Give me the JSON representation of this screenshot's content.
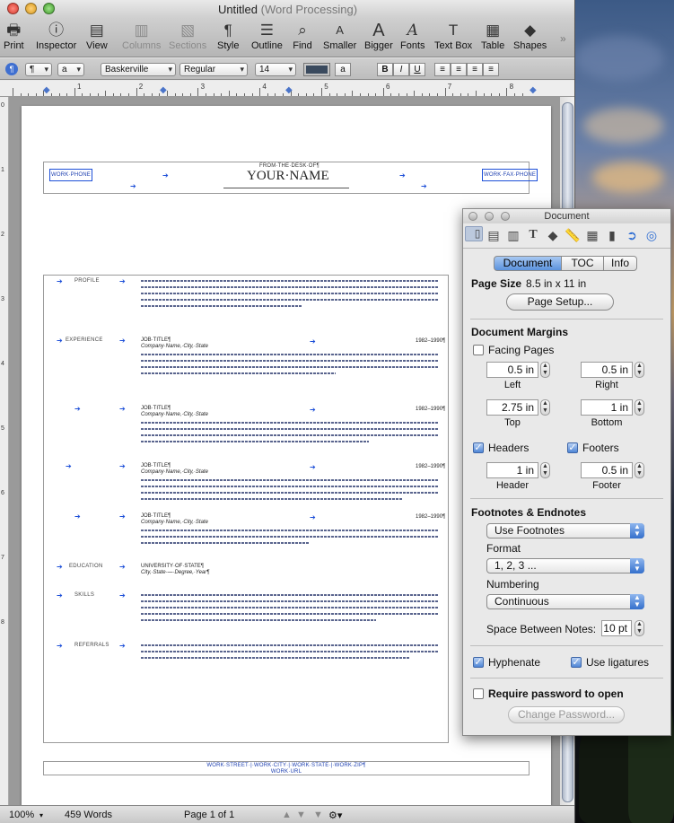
{
  "window": {
    "title": "Untitled",
    "subtitle": "(Word Processing)"
  },
  "toolbar": {
    "items": [
      {
        "label": "Print",
        "icon": "printer-icon",
        "enabled": true
      },
      {
        "label": "Inspector",
        "icon": "info-icon",
        "enabled": true
      },
      {
        "label": "View",
        "icon": "view-icon",
        "enabled": true
      },
      {
        "label": "Columns",
        "icon": "columns-icon",
        "enabled": false
      },
      {
        "label": "Sections",
        "icon": "sections-icon",
        "enabled": false
      },
      {
        "label": "Style",
        "icon": "paragraph-icon",
        "enabled": true
      },
      {
        "label": "Outline",
        "icon": "outline-icon",
        "enabled": true
      },
      {
        "label": "Find",
        "icon": "magnifier-icon",
        "enabled": true
      },
      {
        "label": "Smaller",
        "icon": "smaller-text-icon",
        "enabled": true
      },
      {
        "label": "Bigger",
        "icon": "bigger-text-icon",
        "enabled": true
      },
      {
        "label": "Fonts",
        "icon": "fonts-icon",
        "enabled": true
      },
      {
        "label": "Text Box",
        "icon": "textbox-icon",
        "enabled": true
      },
      {
        "label": "Table",
        "icon": "table-icon",
        "enabled": true
      },
      {
        "label": "Shapes",
        "icon": "shapes-icon",
        "enabled": true
      }
    ],
    "overflow_icon": "chevron-right-icon"
  },
  "formatbar": {
    "paragraph_style": "¶",
    "character_style": "a",
    "font_family": "Baskerville",
    "font_style": "Regular",
    "font_size": "14",
    "text_color_sample": "#3a4a5e",
    "highlight_label": "a",
    "bold": "B",
    "italic": "I",
    "underline": "U"
  },
  "ruler": {
    "h_numbers": [
      "1",
      "2",
      "3",
      "4",
      "5",
      "6",
      "7",
      "8"
    ],
    "v_numbers": [
      "0",
      "1",
      "2",
      "3",
      "4",
      "5",
      "6",
      "7",
      "8"
    ]
  },
  "document": {
    "header": {
      "from_desk": "FROM·THE·DESK·OF¶",
      "name": "YOUR·NAME",
      "work_phone": "WORK·PHONE",
      "work_fax": "WORK·FAX·PHONE"
    },
    "sections": [
      {
        "label": "PROFILE"
      },
      {
        "label": "EXPERIENCE",
        "title": "JOB·TITLE¶",
        "sub": "Company·Name,·City,·State",
        "dates": "1982–1990¶"
      },
      {
        "label": "",
        "title": "JOB·TITLE¶",
        "sub": "Company·Name,·City,·State",
        "dates": "1982–1990¶"
      },
      {
        "label": "",
        "title": "JOB·TITLE¶",
        "sub": "Company·Name,·City,·State",
        "dates": "1982–1990¶"
      },
      {
        "label": "",
        "title": "JOB·TITLE¶",
        "sub": "Company·Name,·City,·State",
        "dates": "1982–1990¶"
      },
      {
        "label": "EDUCATION",
        "title": "UNIVERSITY·OF·STATE¶",
        "sub": "City,·State·—·Degree,·Year¶"
      },
      {
        "label": "SKILLS"
      },
      {
        "label": "REFERRALS"
      }
    ],
    "footer": {
      "address": "WORK·STREET·|·WORK·CITY·|·WORK·STATE·|·WORK·ZIP¶",
      "url": "WORK·URL"
    }
  },
  "status": {
    "zoom": "100%",
    "word_count": "459 Words",
    "page": "Page 1 of 1"
  },
  "inspector": {
    "title": "Document",
    "tabs": [
      "Document",
      "TOC",
      "Info"
    ],
    "active_tab": "Document",
    "page_size_label": "Page Size",
    "page_size_value": "8.5 in x 11 in",
    "page_setup_button": "Page Setup...",
    "margins_heading": "Document Margins",
    "facing_pages": {
      "label": "Facing Pages",
      "checked": false
    },
    "left": {
      "value": "0.5 in",
      "label": "Left"
    },
    "right": {
      "value": "0.5 in",
      "label": "Right"
    },
    "top": {
      "value": "2.75 in",
      "label": "Top"
    },
    "bottom": {
      "value": "1 in",
      "label": "Bottom"
    },
    "headers": {
      "label": "Headers",
      "checked": true
    },
    "footers": {
      "label": "Footers",
      "checked": true
    },
    "header_margin": {
      "value": "1 in",
      "label": "Header"
    },
    "footer_margin": {
      "value": "0.5 in",
      "label": "Footer"
    },
    "footnotes_heading": "Footnotes & Endnotes",
    "footnote_mode": "Use Footnotes",
    "format_label": "Format",
    "format_value": "1, 2, 3 ...",
    "numbering_label": "Numbering",
    "numbering_value": "Continuous",
    "space_between_label": "Space Between Notes:",
    "space_between_value": "10 pt",
    "hyphenate": {
      "label": "Hyphenate",
      "checked": true
    },
    "ligatures": {
      "label": "Use ligatures",
      "checked": true
    },
    "password": {
      "label": "Require password to open",
      "checked": false
    },
    "change_password_button": "Change Password..."
  }
}
